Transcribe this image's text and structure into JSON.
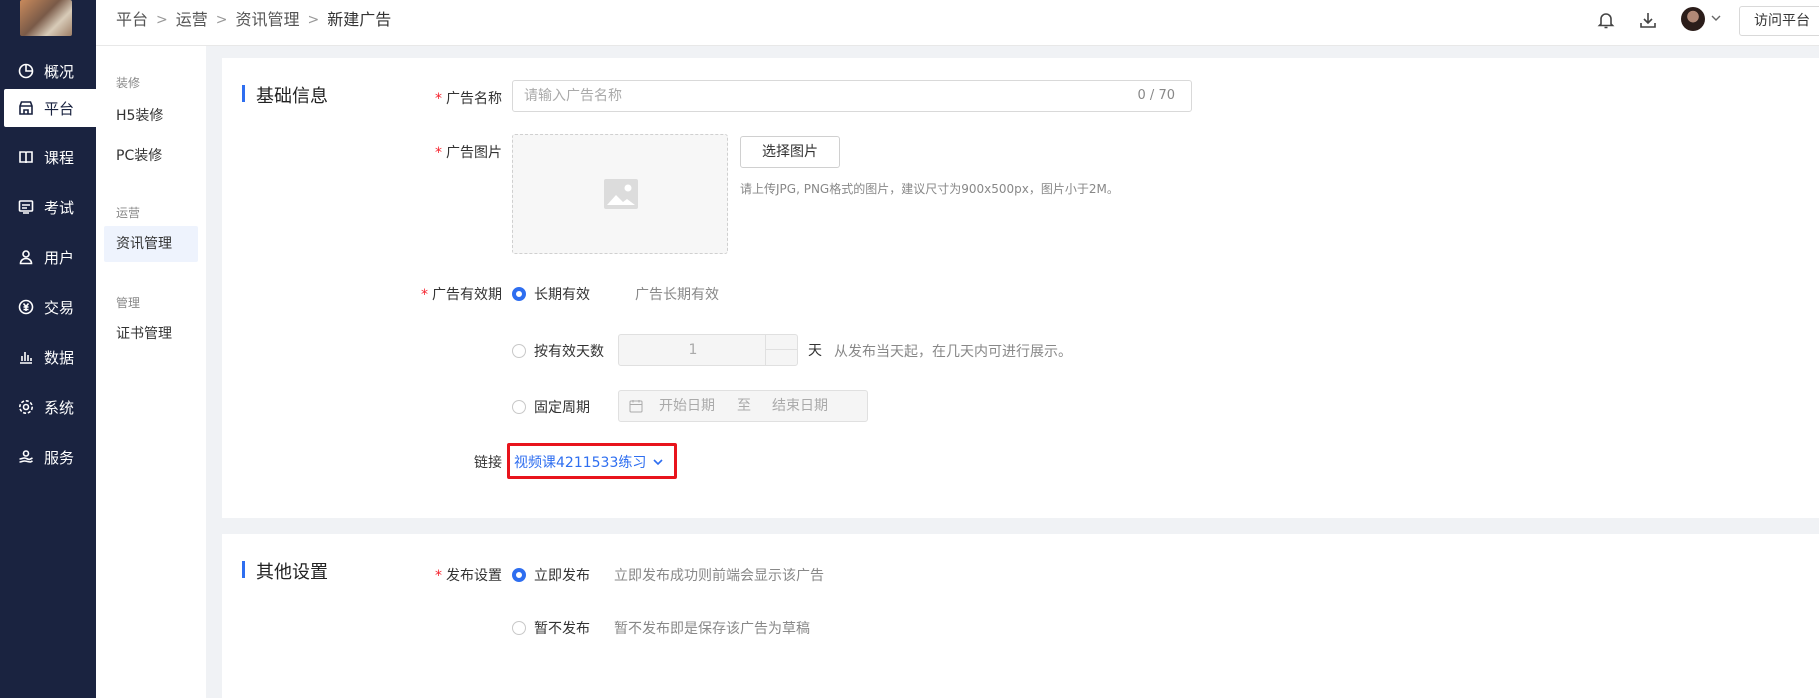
{
  "sidebar": {
    "items": [
      {
        "label": "概况",
        "icon": "pie-chart-icon"
      },
      {
        "label": "平台",
        "icon": "store-icon"
      },
      {
        "label": "课程",
        "icon": "book-icon"
      },
      {
        "label": "考试",
        "icon": "exam-icon"
      },
      {
        "label": "用户",
        "icon": "user-icon"
      },
      {
        "label": "交易",
        "icon": "currency-icon"
      },
      {
        "label": "数据",
        "icon": "bar-chart-icon"
      },
      {
        "label": "系统",
        "icon": "gear-icon"
      },
      {
        "label": "服务",
        "icon": "service-icon"
      }
    ],
    "active_index": 1
  },
  "subnav": {
    "groups": [
      {
        "title": "装修",
        "items": [
          "H5装修",
          "PC装修"
        ]
      },
      {
        "title": "运营",
        "items": [
          "资讯管理"
        ]
      },
      {
        "title": "管理",
        "items": [
          "证书管理"
        ]
      }
    ],
    "active_item": "资讯管理"
  },
  "header": {
    "breadcrumb": [
      "平台",
      "运营",
      "资讯管理",
      "新建广告"
    ],
    "visit_label": "访问平台"
  },
  "basic": {
    "title": "基础信息",
    "name_label": "广告名称",
    "name_placeholder": "请输入广告名称",
    "name_count": "0 / 70",
    "image_label": "广告图片",
    "choose_image": "选择图片",
    "image_hint": "请上传JPG, PNG格式的图片，建议尺寸为900x500px，图片小于2M。",
    "validity_label": "广告有效期",
    "validity_options": [
      {
        "label": "长期有效",
        "desc": "广告长期有效",
        "checked": true
      },
      {
        "label": "按有效天数",
        "checked": false
      },
      {
        "label": "固定周期",
        "checked": false
      }
    ],
    "days_value": "1",
    "days_unit": "天",
    "days_hint": "从发布当天起，在几天内可进行展示。",
    "date_start": "开始日期",
    "date_to": "至",
    "date_end": "结束日期",
    "link_label": "链接",
    "link_value": "视频课4211533练习"
  },
  "other": {
    "title": "其他设置",
    "publish_label": "发布设置",
    "publish_options": [
      {
        "label": "立即发布",
        "desc": "立即发布成功则前端会显示该广告",
        "checked": true
      },
      {
        "label": "暂不发布",
        "desc": "暂不发布即是保存该广告为草稿",
        "checked": false
      }
    ]
  },
  "colors": {
    "accent": "#2e6ef0",
    "sidebar": "#1a2340",
    "highlight": "#e8141c",
    "required": "#f5222d"
  }
}
